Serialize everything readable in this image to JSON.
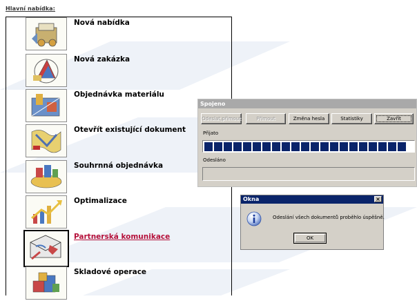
{
  "menu": {
    "title": "Hlavní nabídka:",
    "items": [
      {
        "label": "Nová nabídka",
        "icon": "offer-icon"
      },
      {
        "label": "Nová zakázka",
        "icon": "order-icon"
      },
      {
        "label": "Objednávka materiálu",
        "icon": "material-order-icon"
      },
      {
        "label": "Otevřít existující dokument",
        "icon": "open-document-icon"
      },
      {
        "label": "Souhrnná objednávka",
        "icon": "summary-order-icon"
      },
      {
        "label": "Optimalizace",
        "icon": "optimization-icon"
      },
      {
        "label": "Partnerská komunikace",
        "icon": "partner-communication-icon",
        "active": true
      },
      {
        "label": "Skladové operace",
        "icon": "warehouse-icon"
      }
    ]
  },
  "connection_window": {
    "title": "Spojeno",
    "buttons": [
      {
        "label": "Odeslat,přimout",
        "disabled": true
      },
      {
        "label": "Přimout",
        "disabled": true
      },
      {
        "label": "Změna hesla",
        "disabled": false
      },
      {
        "label": "Statistiky",
        "disabled": false
      },
      {
        "label": "Zavřít",
        "disabled": false
      }
    ],
    "received_label": "Přijato",
    "received_progress": 1.0,
    "sent_label": "Odesláno",
    "sent_progress": 0
  },
  "message_dialog": {
    "title": "Okna",
    "close_glyph": "×",
    "message": "Odeslání všech dokumentů proběhlo úspěšně.",
    "ok_label": "OK",
    "icon": "info-icon"
  },
  "colors": {
    "active_link": "#b5103a",
    "progress": "#0a246a",
    "dialog_titlebar": "#0a246a"
  }
}
